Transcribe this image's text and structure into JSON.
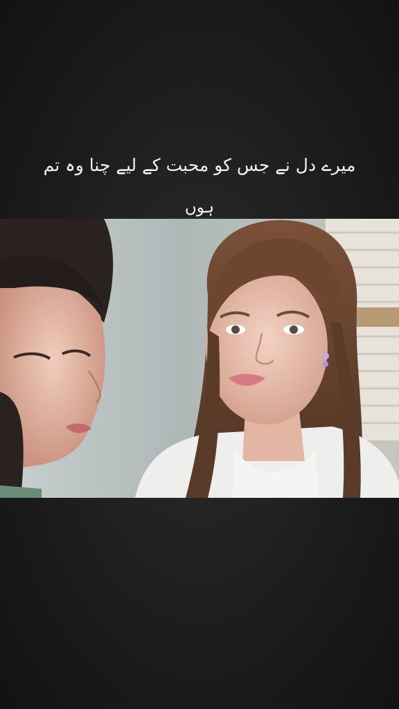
{
  "caption": {
    "line1": "میرے دل نے جس کو محبت کے لیے چنا وہ تم",
    "line2": "ہوں"
  },
  "scene": {
    "colors": {
      "background": "#1d1d1d",
      "wall": "#b9c2c2",
      "blinds": "#e6e2da",
      "hair_left": "#2a2220",
      "hair_right": "#6a4632",
      "skin": "#e8bfae",
      "blouse": "#eeeeec"
    }
  }
}
